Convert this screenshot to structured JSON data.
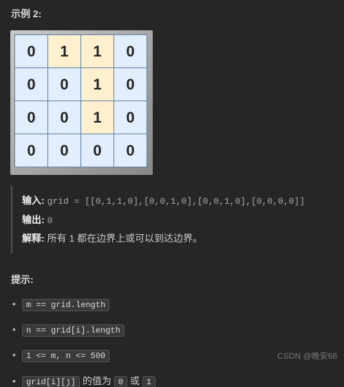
{
  "example": {
    "title": "示例 2:",
    "grid": [
      [
        0,
        1,
        1,
        0
      ],
      [
        0,
        0,
        1,
        0
      ],
      [
        0,
        0,
        1,
        0
      ],
      [
        0,
        0,
        0,
        0
      ]
    ]
  },
  "io": {
    "input_label": "输入:",
    "input_value": "grid = [[0,1,1,0],[0,0,1,0],[0,0,1,0],[0,0,0,0]]",
    "output_label": "输出:",
    "output_value": "0",
    "explain_label": "解释:",
    "explain_value": "所有 1 都在边界上或可以到达边界。"
  },
  "hints": {
    "title": "提示:",
    "items": [
      {
        "code": "m == grid.length",
        "suffix": ""
      },
      {
        "code": "n == grid[i].length",
        "suffix": ""
      },
      {
        "code": "1 <= m, n <= 500",
        "suffix": ""
      },
      {
        "code_parts": [
          "grid[i][j]",
          "0",
          "1"
        ],
        "template": "{0} 的值为 {1} 或 {2}"
      }
    ]
  },
  "watermark": "CSDN @晚安66"
}
